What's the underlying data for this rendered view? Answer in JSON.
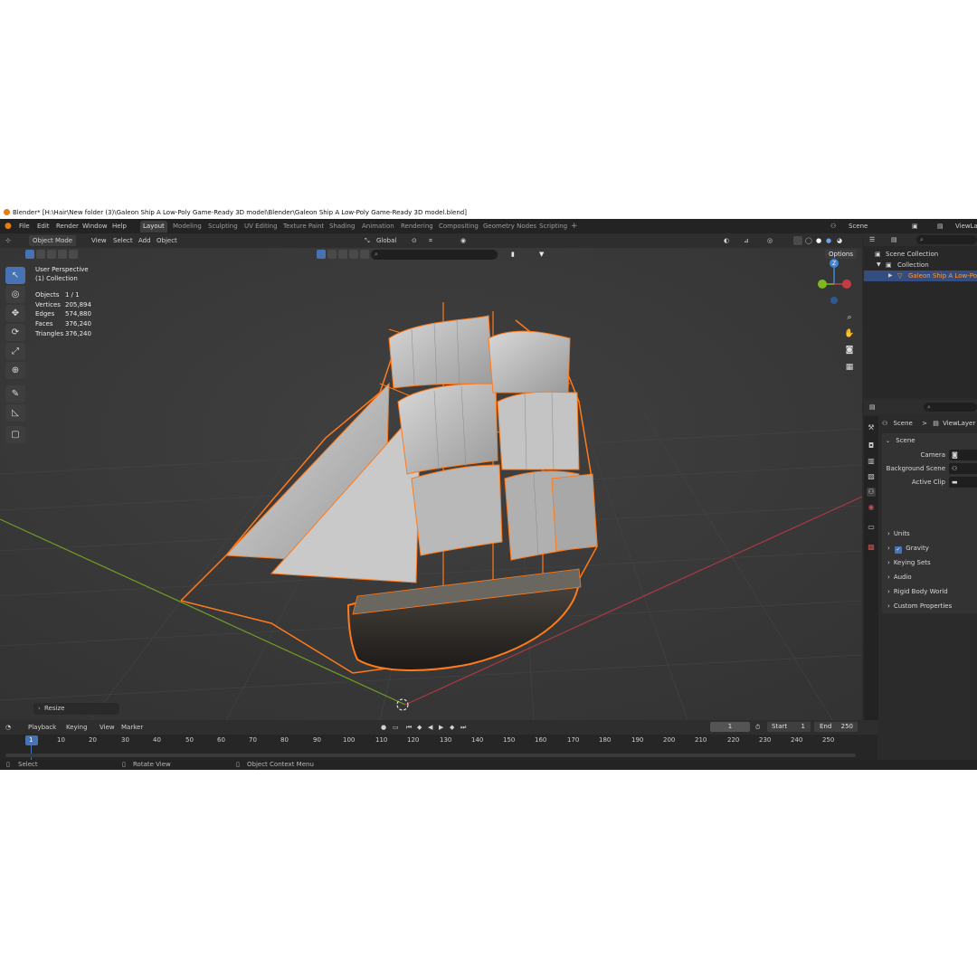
{
  "window": {
    "title": "Blender* [H:\\Hair\\New folder (3)\\Galeon Ship A Low-Poly Game-Ready 3D model\\Blender\\Galeon Ship A Low-Poly Game-Ready 3D model.blend]"
  },
  "menu": [
    "File",
    "Edit",
    "Render",
    "Window",
    "Help"
  ],
  "workspaces": [
    "Layout",
    "Modeling",
    "Sculpting",
    "UV Editing",
    "Texture Paint",
    "Shading",
    "Animation",
    "Rendering",
    "Compositing",
    "Geometry Nodes",
    "Scripting"
  ],
  "add_workspace": "+",
  "scene_selector": "Scene",
  "viewlayer_selector": "ViewLay",
  "viewport_header": {
    "mode": "Object Mode",
    "menus": [
      "View",
      "Select",
      "Add",
      "Object"
    ],
    "orientation": "Global",
    "options": "Options"
  },
  "viewport_overlay": {
    "view_name": "User Perspective",
    "collection": "(1) Collection",
    "stats": [
      {
        "label": "Objects",
        "value": "1 / 1"
      },
      {
        "label": "Vertices",
        "value": "205,894"
      },
      {
        "label": "Edges",
        "value": "574,880"
      },
      {
        "label": "Faces",
        "value": "376,240"
      },
      {
        "label": "Triangles",
        "value": "376,240"
      }
    ],
    "operator_panel": "Resize"
  },
  "gizmo": {
    "z": "Z"
  },
  "outliner": {
    "rows": [
      {
        "label": "Scene Collection"
      },
      {
        "label": "Collection"
      },
      {
        "label": "Galeon Ship A Low-Poly G"
      }
    ]
  },
  "properties": {
    "breadcrumb_scene": "Scene",
    "breadcrumb_sep": ">",
    "breadcrumb_viewlayer": "ViewLayer",
    "scene_panel": "Scene",
    "fields": [
      {
        "label": "Camera"
      },
      {
        "label": "Background Scene"
      },
      {
        "label": "Active Clip"
      }
    ],
    "sections": [
      "Units",
      "Gravity",
      "Keying Sets",
      "Audio",
      "Rigid Body World",
      "Custom Properties"
    ],
    "gravity_checked": true
  },
  "timeline": {
    "menus": [
      "Playback",
      "Keying",
      "View",
      "Marker"
    ],
    "current_frame": "1",
    "start_label": "Start",
    "start": "1",
    "end_label": "End",
    "end": "250",
    "ticks": [
      "1",
      "10",
      "20",
      "30",
      "40",
      "50",
      "60",
      "70",
      "80",
      "90",
      "100",
      "110",
      "120",
      "130",
      "140",
      "150",
      "160",
      "170",
      "180",
      "190",
      "200",
      "210",
      "220",
      "230",
      "240",
      "250"
    ]
  },
  "statusbar": [
    "Select",
    "Rotate View",
    "Object Context Menu"
  ],
  "colors": {
    "selection_orange": "#ff7a1a",
    "active_blue": "#4772b3",
    "x_axis": "#c83a45",
    "y_axis": "#7fb81e",
    "z_axis": "#3f86d8"
  }
}
